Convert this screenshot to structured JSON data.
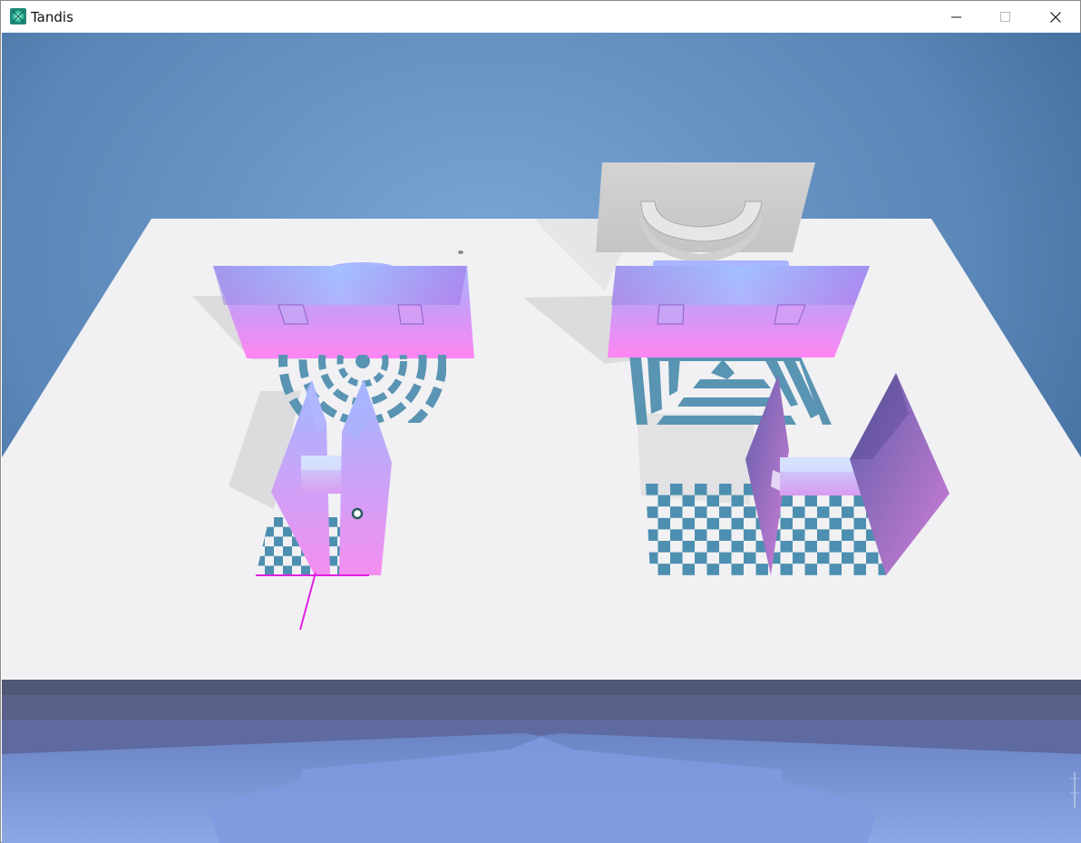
{
  "window": {
    "title": "Tandis",
    "controls": {
      "minimize_icon": "minimize-icon",
      "maximize_icon": "maximize-icon",
      "close_icon": "close-icon"
    }
  },
  "scene": {
    "sky_color_top": "#3d6a9a",
    "sky_color_mid": "#6b9ac8",
    "table_color": "#f0f0f2",
    "gradient_colors": [
      "#9ec4ff",
      "#b47cf0",
      "#ff86f0"
    ],
    "pattern_color": "#4d8fb0",
    "cursor_line_color": "#e020e0",
    "floor_color": "#7e98d8"
  }
}
